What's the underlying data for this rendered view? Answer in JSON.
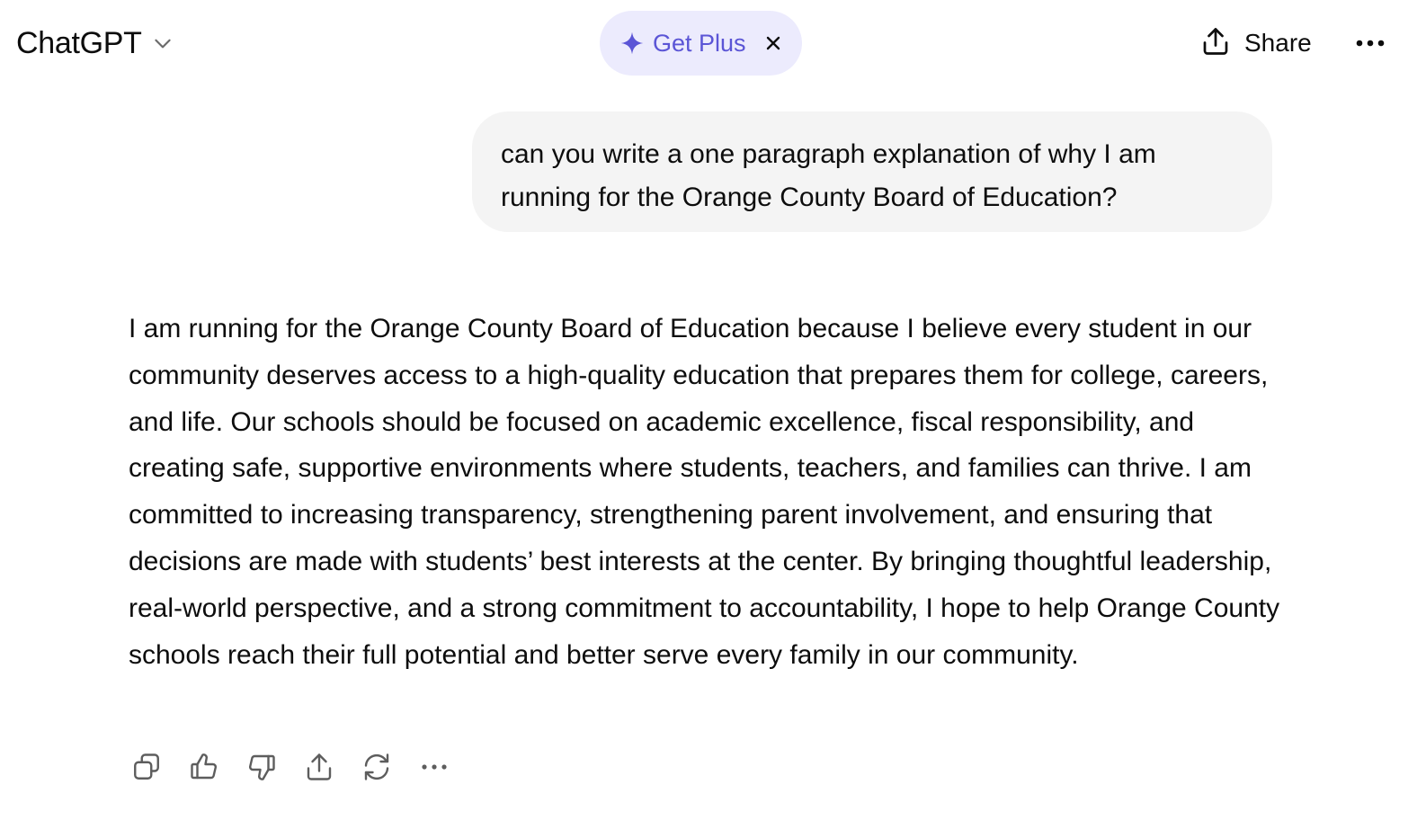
{
  "header": {
    "model_name": "ChatGPT",
    "upgrade_label": "Get Plus",
    "share_label": "Share"
  },
  "colors": {
    "accent": "#5b55d6",
    "upgrade_bg": "#ecebfd",
    "user_bubble_bg": "#f4f4f4",
    "text": "#0d0d0d"
  },
  "conversation": {
    "user_message": "can you write a one paragraph explanation of why I am running for the Orange County Board of Education?",
    "assistant_message": "I am running for the Orange County Board of Education because I believe every student in our community deserves access to a high-quality education that prepares them for college, careers, and life. Our schools should be focused on academic excellence, fiscal responsibility, and creating safe, supportive environments where students, teachers, and families can thrive. I am committed to increasing transparency, strengthening parent involvement, and ensuring that decisions are made with students’ best interests at the center. By bringing thoughtful leadership, real-world perspective, and a strong commitment to accountability, I hope to help Orange County schools reach their full potential and better serve every family in our community."
  },
  "icons": {
    "model_switcher": "chevron-down-icon",
    "upgrade": "sparkle-icon",
    "dismiss": "close-icon",
    "share": "share-icon",
    "menu": "more-icon",
    "message_actions": [
      "copy-icon",
      "thumbs-up-icon",
      "thumbs-down-icon",
      "share-icon",
      "regenerate-icon",
      "more-icon"
    ]
  }
}
